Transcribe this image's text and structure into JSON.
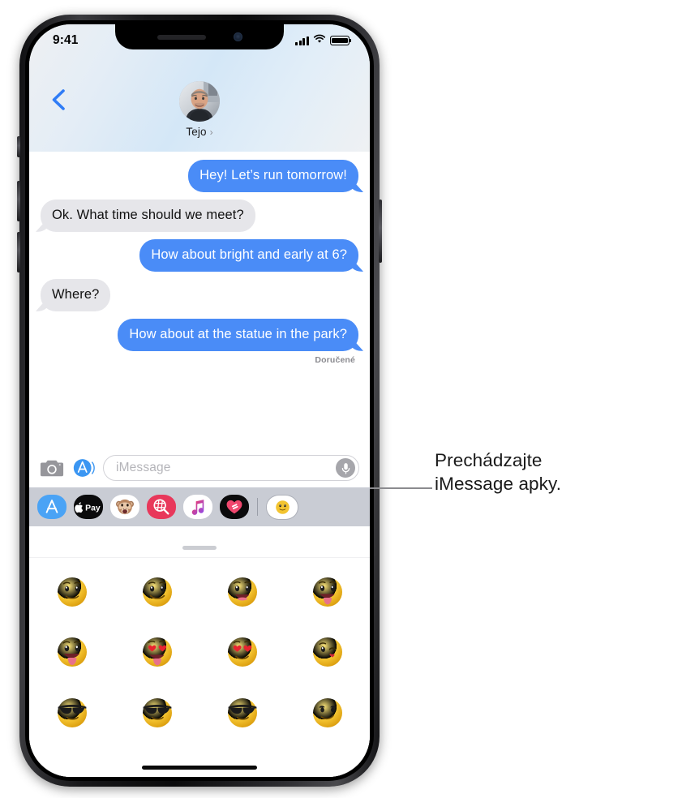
{
  "status_bar": {
    "time": "9:41",
    "signal_icon": "cellular-bars-icon",
    "wifi_icon": "wifi-icon",
    "battery_icon": "battery-full-icon"
  },
  "header": {
    "back_icon": "back-chevron-icon",
    "contact_name": "Tejo",
    "contact_chevron": "›",
    "avatar_icon": "contact-avatar-photo"
  },
  "conversation": {
    "messages": [
      {
        "text": "Hey! Let’s run tomorrow!",
        "direction": "out"
      },
      {
        "text": "Ok. What time should we meet?",
        "direction": "in"
      },
      {
        "text": "How about bright and early at 6?",
        "direction": "out"
      },
      {
        "text": "Where?",
        "direction": "in"
      },
      {
        "text": "How about at the statue in the park?",
        "direction": "out"
      }
    ],
    "delivered_label": "Doručené"
  },
  "input_bar": {
    "camera_icon": "camera-icon",
    "appstore_icon": "app-store-icon",
    "placeholder": "iMessage",
    "mic_icon": "microphone-icon"
  },
  "app_drawer": {
    "apps": [
      {
        "name": "app-store",
        "label": "App Store"
      },
      {
        "name": "apple-pay",
        "label": "Apple Pay"
      },
      {
        "name": "memoji",
        "label": "Memoji"
      },
      {
        "name": "images",
        "label": "#images"
      },
      {
        "name": "apple-music",
        "label": "Apple Music"
      },
      {
        "name": "digital-touch",
        "label": "Digital Touch"
      },
      {
        "name": "emoji-stickers",
        "label": "Smiley Stickers",
        "selected": true
      }
    ]
  },
  "emoji_keyboard": {
    "grabber_icon": "drag-handle-icon",
    "stickers": [
      {
        "name": "slightly-smiling-face"
      },
      {
        "name": "smiling-face"
      },
      {
        "name": "grinning-face-open-mouth"
      },
      {
        "name": "face-with-tongue"
      },
      {
        "name": "face-with-tongue-open-eyes"
      },
      {
        "name": "heart-eyes-with-tongue"
      },
      {
        "name": "smiling-face-with-heart-eyes"
      },
      {
        "name": "winking-face-blowing-kiss"
      },
      {
        "name": "smiling-face-with-sunglasses"
      },
      {
        "name": "smiling-face-with-sunglasses-2"
      },
      {
        "name": "smiling-face-with-sunglasses-3"
      },
      {
        "name": "smirking-face"
      }
    ],
    "home_indicator": "home-indicator"
  },
  "callout": {
    "line1": "Prechádzajte",
    "line2": "iMessage apky."
  },
  "colors": {
    "outgoing_bubble": "#4a8cf7",
    "incoming_bubble": "#e6e6ea",
    "drawer_background": "#c9ccd4",
    "accent_blue": "#2f7cf6"
  }
}
